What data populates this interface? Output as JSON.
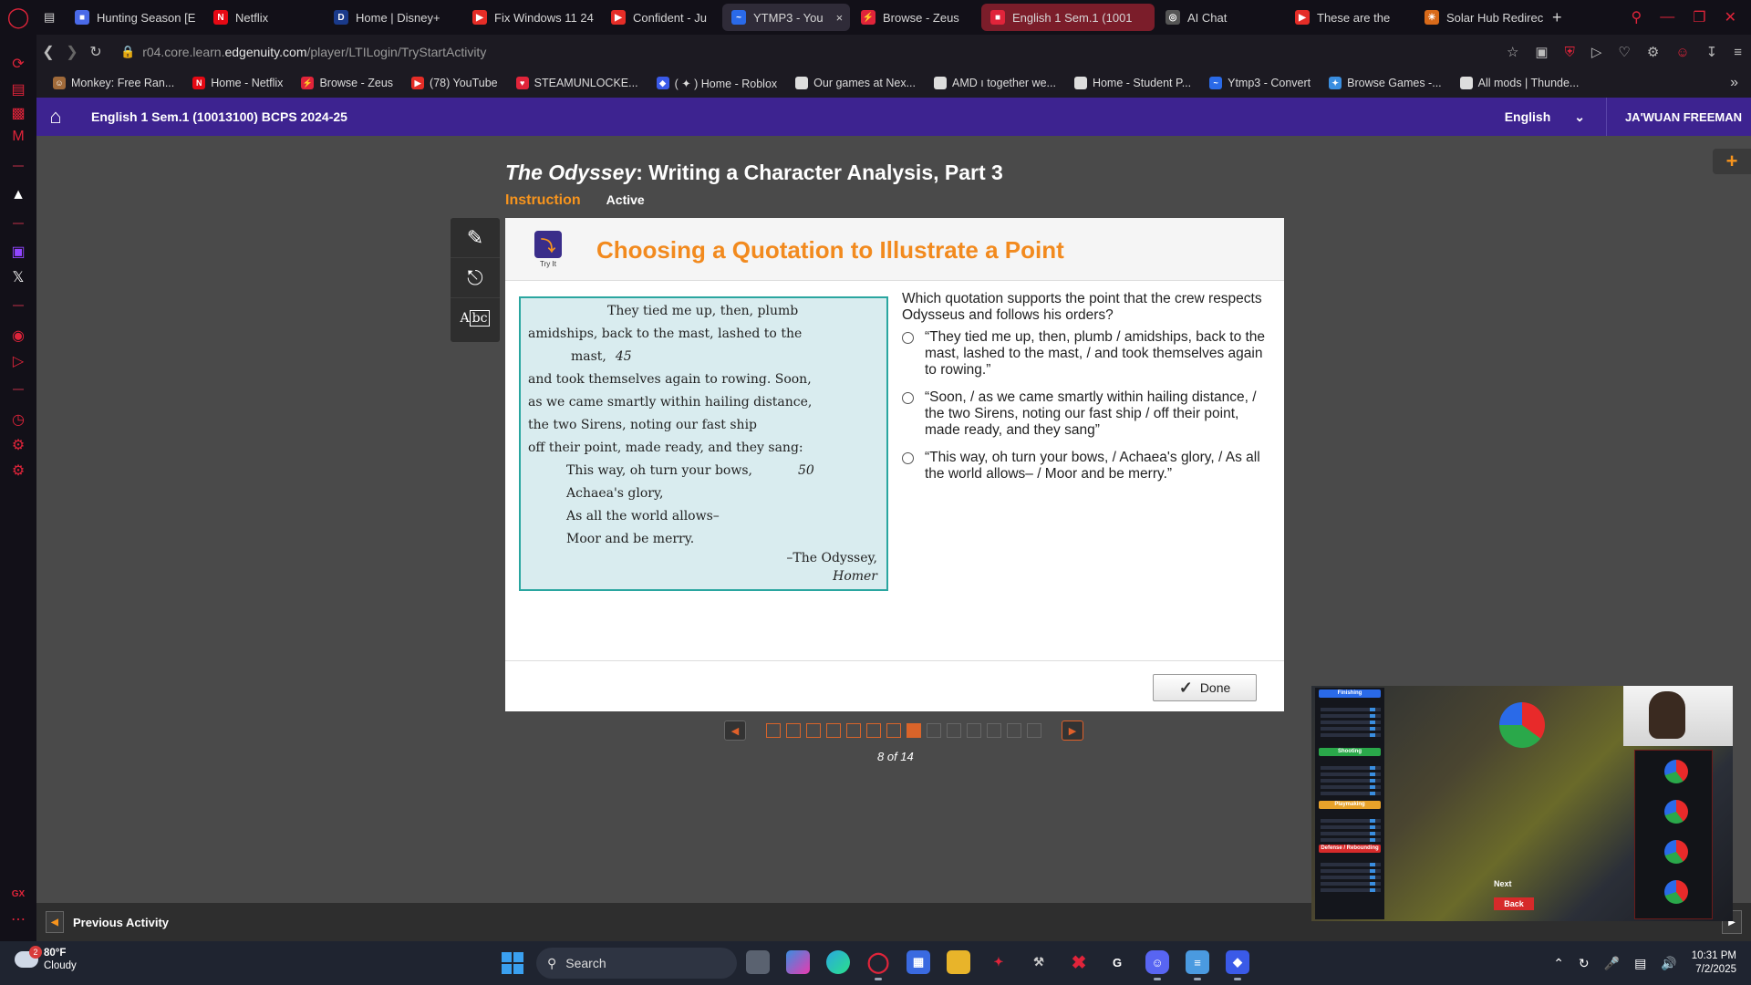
{
  "browser": {
    "tabs": [
      {
        "label": "Hunting Season [E",
        "fav": "#4a6ae8",
        "icon": "■"
      },
      {
        "label": "Netflix",
        "fav": "#e50914",
        "icon": "N"
      },
      {
        "label": "Home | Disney+",
        "fav": "#1a3a8a",
        "icon": "D"
      },
      {
        "label": "Fix Windows 11 24",
        "fav": "#e52d27",
        "icon": "▶"
      },
      {
        "label": "Confident - Ju",
        "fav": "#e52d27",
        "icon": "▶"
      },
      {
        "label": "YTMP3 - You",
        "fav": "#2a6ae8",
        "icon": "~",
        "close": "×"
      },
      {
        "label": "Browse - Zeus",
        "fav": "#e0243a",
        "icon": "⚡"
      },
      {
        "label": "English 1 Sem.1 (1001",
        "fav": "#e0243a",
        "icon": "■"
      },
      {
        "label": "AI Chat",
        "fav": "#555",
        "icon": "◎"
      },
      {
        "label": "These are the",
        "fav": "#e52d27",
        "icon": "▶"
      },
      {
        "label": "Solar Hub Redirec",
        "fav": "#d86a1a",
        "icon": "☀"
      }
    ],
    "new_tab": "+",
    "url_prefix": "r04.core.learn.",
    "url_domain": "edgenuity.com",
    "url_path": "/player/LTILogin/TryStartActivity",
    "bookmarks": [
      {
        "label": "Monkey: Free Ran...",
        "fav": "#a06a3a",
        "icon": "☺"
      },
      {
        "label": "Home - Netflix",
        "fav": "#e50914",
        "icon": "N"
      },
      {
        "label": "Browse - Zeus",
        "fav": "#e0243a",
        "icon": "⚡"
      },
      {
        "label": "(78) YouTube",
        "fav": "#e52d27",
        "icon": "▶"
      },
      {
        "label": "STEAMUNLOCKE...",
        "fav": "#e0243a",
        "icon": "♥"
      },
      {
        "label": "( ✦ ) Home - Roblox",
        "fav": "#3a5ae8",
        "icon": "◆"
      },
      {
        "label": "Our games at Nex...",
        "fav": "#ddd",
        "icon": ""
      },
      {
        "label": "AMD ı together we...",
        "fav": "#ddd",
        "icon": ""
      },
      {
        "label": "Home - Student P...",
        "fav": "#ddd",
        "icon": ""
      },
      {
        "label": "Ytmp3 - Convert",
        "fav": "#2a6ae8",
        "icon": "~"
      },
      {
        "label": "Browse Games -...",
        "fav": "#3a8ee0",
        "icon": "✦"
      },
      {
        "label": "All mods | Thunde...",
        "fav": "#ddd",
        "icon": ""
      }
    ]
  },
  "header": {
    "course": "English 1 Sem.1 (10013100) BCPS 2024-25",
    "language": "English",
    "user": "JA'WUAN FREEMAN"
  },
  "lesson": {
    "title_italic": "The Odyssey",
    "title_rest": ": Writing a Character Analysis, Part 3",
    "tab_instruction": "Instruction",
    "status": "Active"
  },
  "card": {
    "badge": "Try It",
    "title": "Choosing a Quotation to Illustrate a Point",
    "passage": [
      {
        "text": "They tied me up, then, plumb",
        "num": ""
      },
      {
        "text": "amidships, back to the mast, lashed to the",
        "num": ""
      },
      {
        "text": "mast,",
        "num": "45"
      },
      {
        "text": "and took themselves again to rowing. Soon,",
        "num": ""
      },
      {
        "text": "as we came smartly within hailing distance,",
        "num": ""
      },
      {
        "text": "the two Sirens, noting our fast ship",
        "num": ""
      },
      {
        "text": "off their point, made ready, and they sang:",
        "num": ""
      },
      {
        "text": "This way, oh turn your bows,",
        "num": "50"
      },
      {
        "text": "Achaea's glory,",
        "num": ""
      },
      {
        "text": "As all the world allows–",
        "num": ""
      },
      {
        "text": "Moor and be merry.",
        "num": ""
      }
    ],
    "attribution_source": "–The Odyssey,",
    "attribution_author": "Homer",
    "question": "Which quotation supports the point that the crew respects Odysseus and follows his orders?",
    "options": [
      "“They tied me up, then, plumb / amidships, back to the mast, lashed to the mast, / and took themselves again to rowing.”",
      "“Soon, / as we came smartly within hailing distance, / the two Sirens, noting our fast ship / off their point, made ready, and they sang”",
      "“This way, oh turn your bows, / Achaea's glory, / As all the world allows– / Moor and be merry.”"
    ],
    "done_label": "Done"
  },
  "pager": {
    "current": 8,
    "total": 14,
    "label": "8 of 14"
  },
  "activity_nav": {
    "previous": "Previous Activity"
  },
  "overlay": {
    "stat_headers": [
      {
        "label": "Finishing",
        "color": "#2a6ae8"
      },
      {
        "label": "Shooting",
        "color": "#2aa84a"
      },
      {
        "label": "Playmaking",
        "color": "#e8a22a"
      },
      {
        "label": "Defense / Rebounding",
        "color": "#d62a2a"
      }
    ],
    "next": "Next",
    "back": "Back"
  },
  "taskbar": {
    "temperature": "80°F",
    "condition": "Cloudy",
    "weather_badge": "2",
    "search": "Search",
    "time": "10:31 PM",
    "date": "7/2/2025"
  }
}
